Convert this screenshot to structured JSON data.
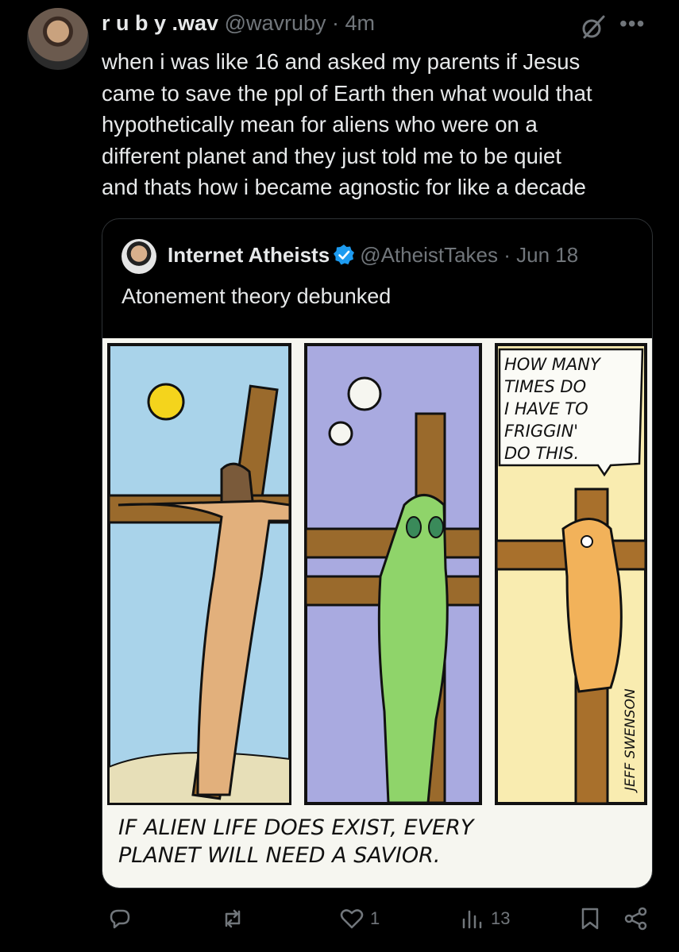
{
  "post": {
    "display_name": "r u b y .wav",
    "handle": "@wavruby",
    "time": "· 4m",
    "text_lines": [
      "when i was like 16 and asked my parents if Jesus",
      "came to save the ppl of Earth then what would that",
      "hypothetically mean for aliens who were on a",
      "different planet and they just told me to be quiet",
      "and thats how i became agnostic for like a decade"
    ]
  },
  "quoted": {
    "display_name": "Internet Atheists",
    "handle": "@AtheistTakes",
    "date": "· Jun 18",
    "text": "Atonement theory debunked",
    "comic": {
      "bubble_lines": [
        "HOW MANY",
        "TIMES DO",
        "I HAVE TO",
        "FRIGGIN'",
        "DO THIS."
      ],
      "caption_lines": [
        "IF ALIEN LIFE DOES EXIST, EVERY",
        "PLANET WILL NEED A SAVIOR."
      ],
      "signature": "JEFF SWENSON"
    }
  },
  "actions": {
    "reply_icon": "reply-icon",
    "repost_icon": "repost-icon",
    "like_icon": "heart-icon",
    "like_count": "1",
    "views_icon": "views-icon",
    "views_count": "13",
    "bookmark_icon": "bookmark-icon",
    "share_icon": "share-icon"
  },
  "colors": {
    "background": "#000000",
    "text": "#e7e9ea",
    "muted": "#71767b",
    "verified": "#1d9bf0"
  }
}
